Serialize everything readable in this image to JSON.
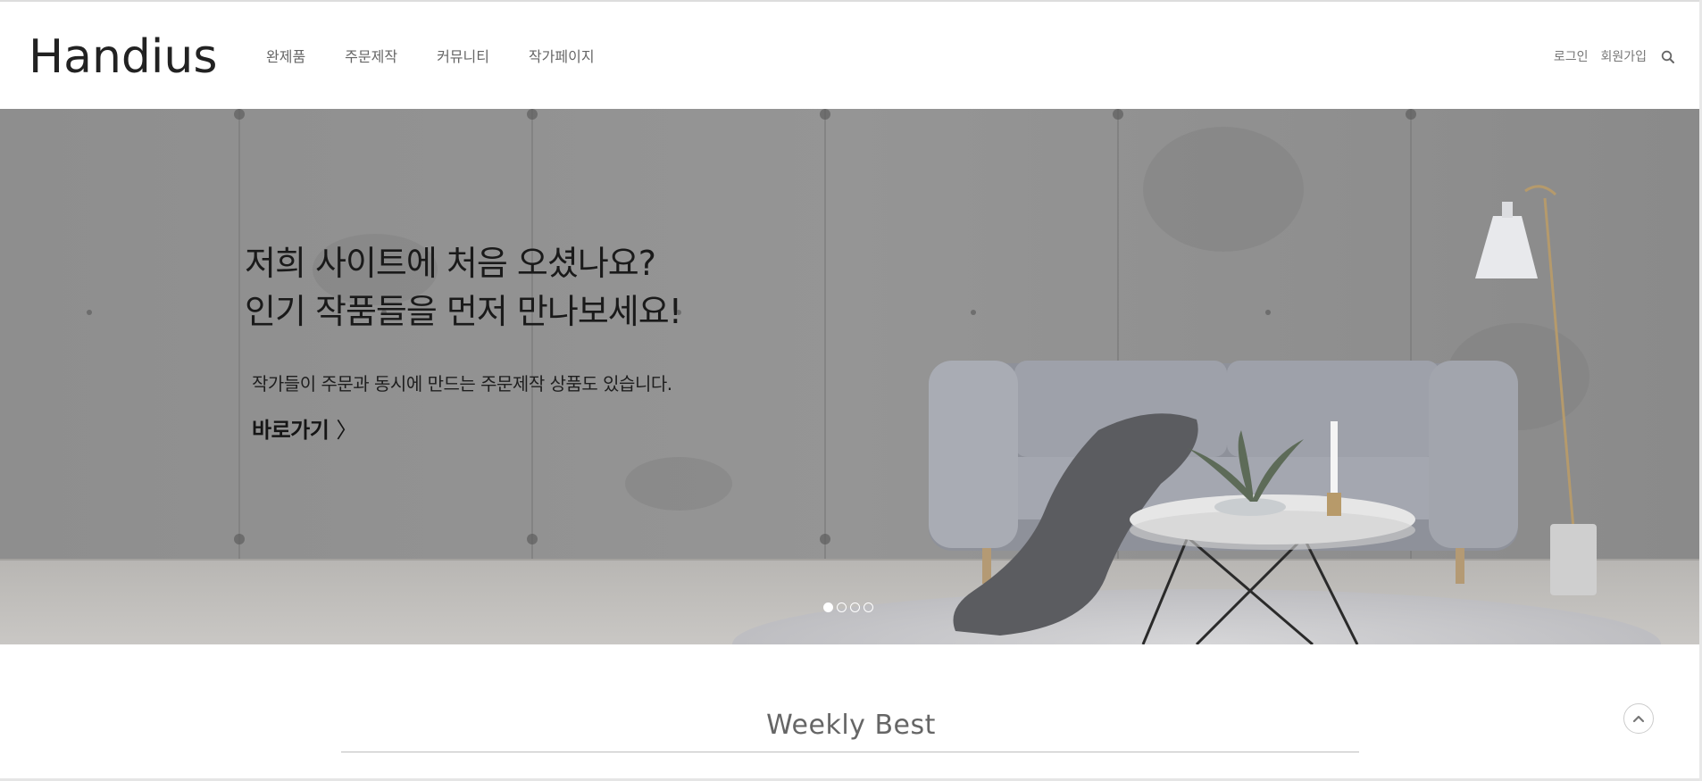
{
  "header": {
    "logo_text": "Handius",
    "nav": [
      {
        "label": "완제품"
      },
      {
        "label": "주문제작"
      },
      {
        "label": "커뮤니티"
      },
      {
        "label": "작가페이지"
      }
    ],
    "util": {
      "login": "로그인",
      "signup": "회원가입",
      "search_icon": "search-icon"
    }
  },
  "hero": {
    "headline_line1": "저희 사이트에 처음 오셨나요?",
    "headline_line2": "인기 작품들을 먼저 만나보세요!",
    "subtext": "작가들이 주문과 동시에 만드는 주문제작 상품도 있습니다.",
    "cta_label": "바로가기",
    "cta_icon": "chevron-right-icon",
    "slides_total": 4,
    "active_slide": 1
  },
  "section": {
    "title": "Weekly Best"
  },
  "scroll_top_icon": "chevron-up-icon",
  "colors": {
    "text_dark": "#1a1a1a",
    "nav_text": "#666666",
    "wall": "#8f8f8f",
    "sofa": "#9fa2ab"
  }
}
